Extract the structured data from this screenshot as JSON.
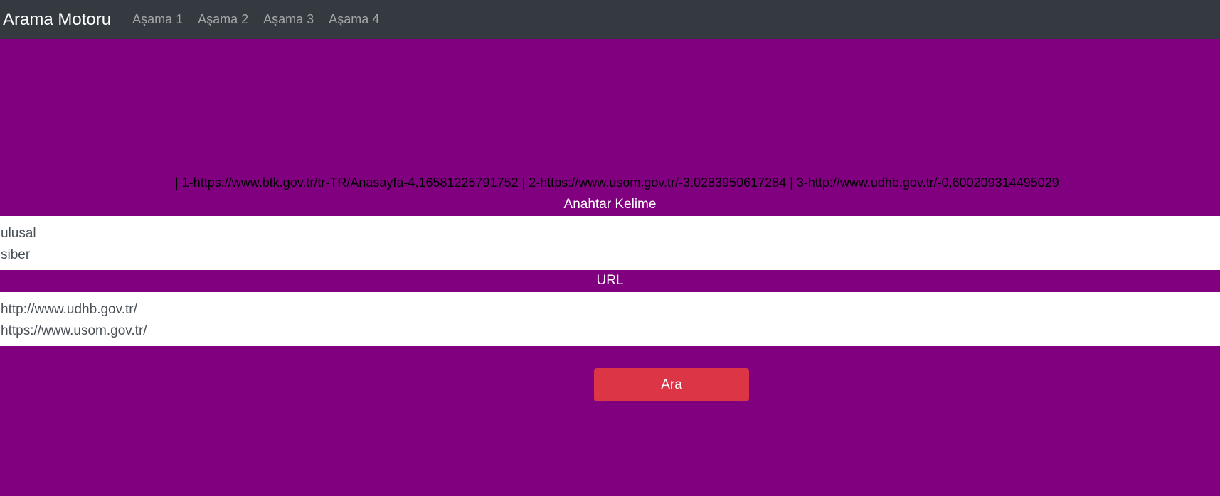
{
  "navbar": {
    "brand": "Arama Motoru",
    "links": [
      "Aşama 1",
      "Aşama 2",
      "Aşama 3",
      "Aşama 4"
    ]
  },
  "results": {
    "text": "| 1-https://www.btk.gov.tr/tr-TR/Anasayfa-4,16581225791752 | 2-https://www.usom.gov.tr/-3,0283950617284 | 3-http://www.udhb.gov.tr/-0,600209314495029"
  },
  "keywords": {
    "label": "Anahtar Kelime",
    "lines": [
      "ulusal",
      "siber"
    ]
  },
  "urls": {
    "label": "URL",
    "lines": [
      "http://www.udhb.gov.tr/",
      "https://www.usom.gov.tr/"
    ]
  },
  "search_button": {
    "label": "Ara"
  },
  "colors": {
    "page_background": "#800080",
    "navbar_background": "#343a40",
    "button_background": "#dc3545"
  }
}
